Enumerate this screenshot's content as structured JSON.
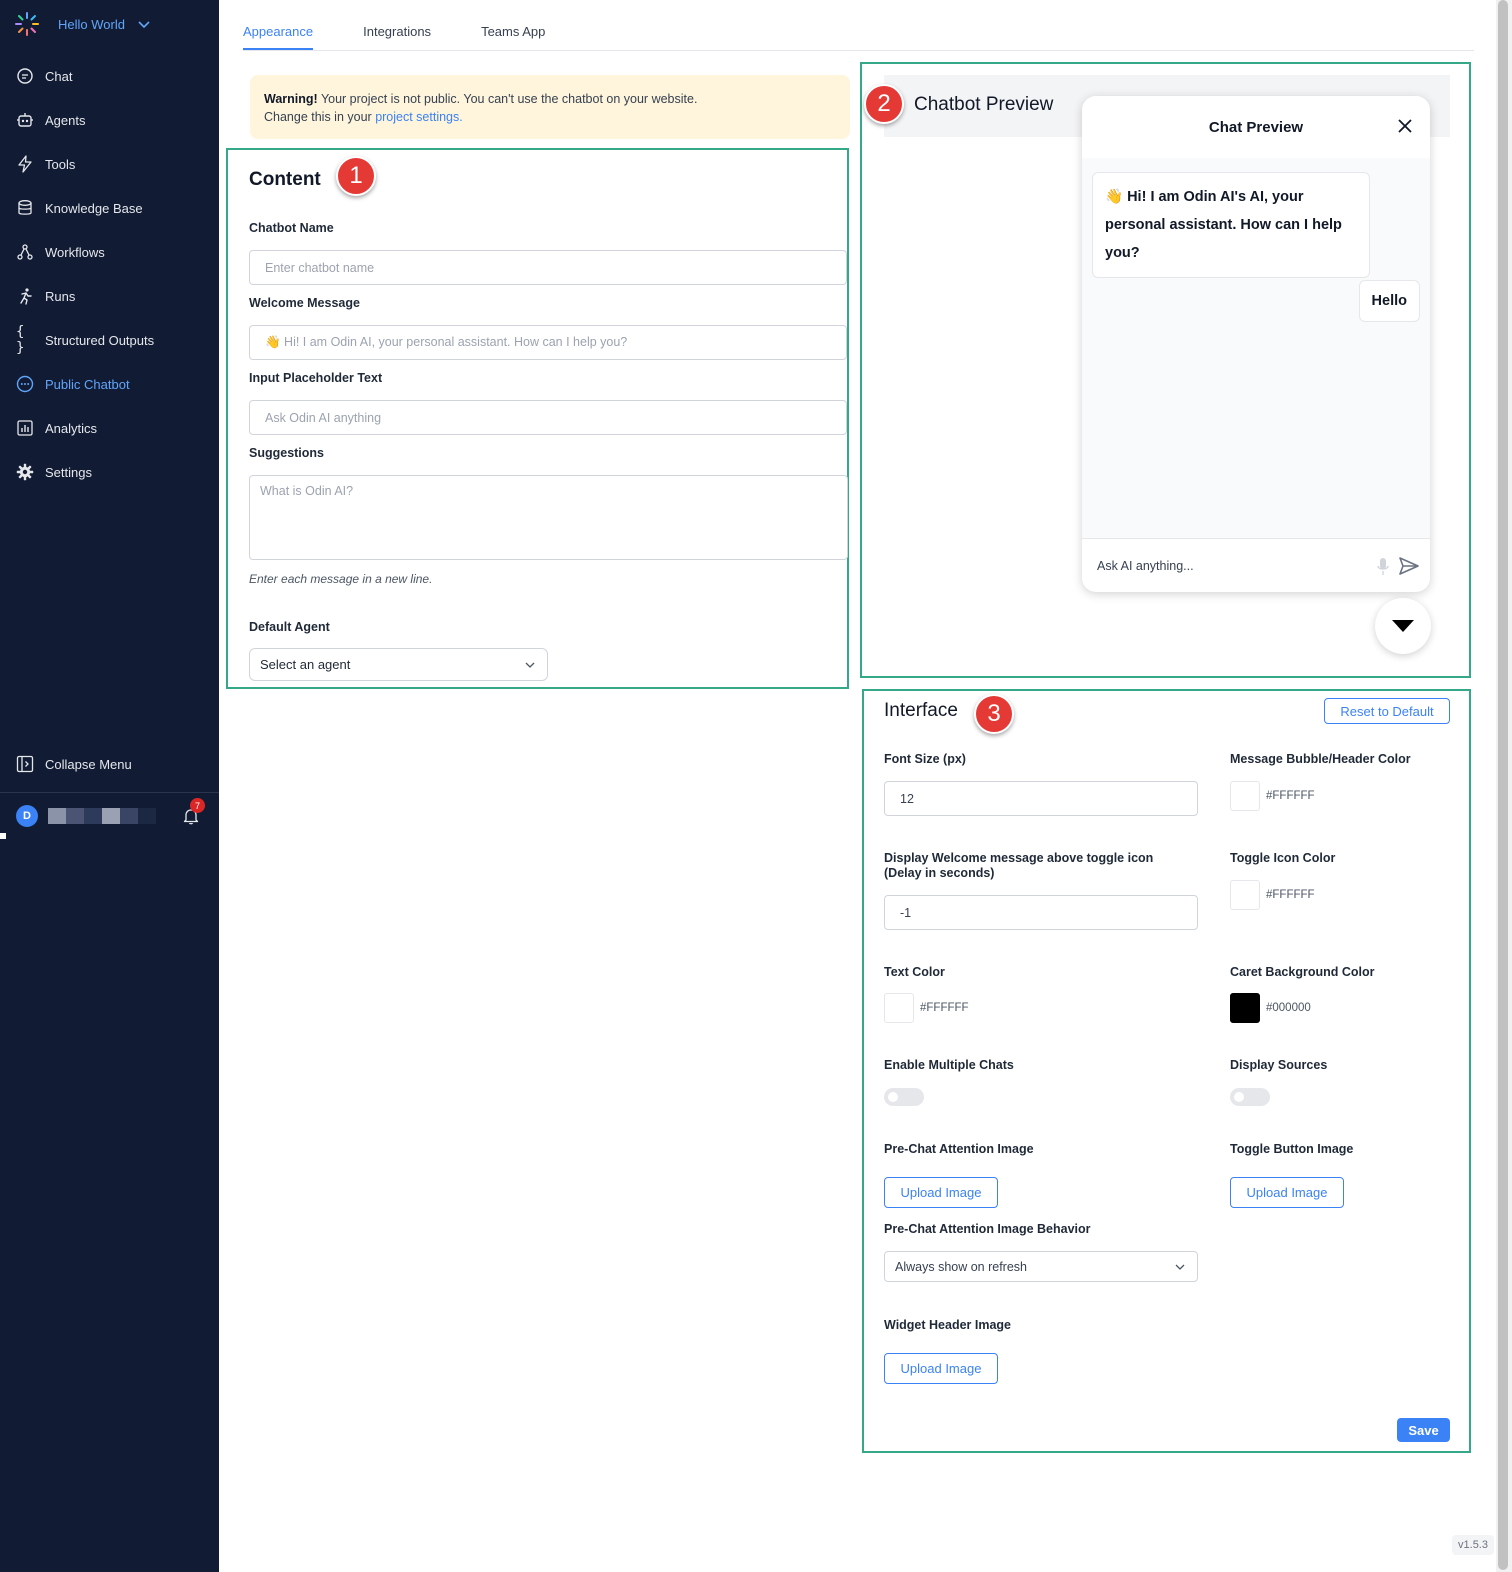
{
  "workspace": {
    "name": "Hello World"
  },
  "sidebar": {
    "items": [
      {
        "label": "Chat",
        "icon": "chat-bubble-icon"
      },
      {
        "label": "Agents",
        "icon": "robot-icon"
      },
      {
        "label": "Tools",
        "icon": "lightning-icon"
      },
      {
        "label": "Knowledge Base",
        "icon": "database-icon"
      },
      {
        "label": "Workflows",
        "icon": "workflow-icon"
      },
      {
        "label": "Runs",
        "icon": "runner-icon"
      },
      {
        "label": "Structured Outputs",
        "icon": "braces-icon"
      },
      {
        "label": "Public Chatbot",
        "icon": "chat-dots-icon",
        "active": true
      },
      {
        "label": "Analytics",
        "icon": "chart-icon"
      },
      {
        "label": "Settings",
        "icon": "gear-icon"
      }
    ],
    "collapse_label": "Collapse Menu",
    "user_initial": "D",
    "notification_count": "7"
  },
  "tabs": [
    {
      "label": "Appearance",
      "active": true
    },
    {
      "label": "Integrations"
    },
    {
      "label": "Teams App"
    }
  ],
  "warning": {
    "bold": "Warning!",
    "text": " Your project is not public. You can't use the chatbot on your website.",
    "line2": "Change this in your ",
    "link": "project settings."
  },
  "content": {
    "title": "Content",
    "badge": "1",
    "chatbot_name_label": "Chatbot Name",
    "chatbot_name_placeholder": "Enter chatbot name",
    "welcome_label": "Welcome Message",
    "welcome_value": "👋 Hi! I am Odin AI, your personal assistant. How can I help you?",
    "input_placeholder_label": "Input Placeholder Text",
    "input_placeholder_value": "Ask Odin AI anything",
    "suggestions_label": "Suggestions",
    "suggestions_placeholder": "What is Odin AI?",
    "suggestions_hint": "Enter each message in a new line.",
    "default_agent_label": "Default Agent",
    "default_agent_value": "Select an agent"
  },
  "preview": {
    "title": "Chatbot Preview",
    "badge": "2",
    "chat_title": "Chat Preview",
    "bot_message": "👋 Hi! I am Odin AI's AI, your personal assistant. How can I help you?",
    "user_message": "Hello",
    "input_placeholder": "Ask AI anything..."
  },
  "interface": {
    "title": "Interface",
    "badge": "3",
    "reset_label": "Reset to Default",
    "font_size_label": "Font Size (px)",
    "font_size_value": "12",
    "bubble_color_label": "Message Bubble/Header Color",
    "bubble_color": "#FFFFFF",
    "display_welcome_label_1": "Display Welcome message above toggle icon",
    "display_welcome_label_2": "(Delay in seconds)",
    "display_welcome_value": "-1",
    "toggle_icon_color_label": "Toggle Icon Color",
    "toggle_icon_color": "#FFFFFF",
    "text_color_label": "Text Color",
    "text_color": "#FFFFFF",
    "caret_bg_label": "Caret Background Color",
    "caret_bg_color": "#000000",
    "enable_multiple_label": "Enable Multiple Chats",
    "enable_multiple": false,
    "display_sources_label": "Display Sources",
    "display_sources": false,
    "pre_chat_image_label": "Pre-Chat Attention Image",
    "toggle_button_image_label": "Toggle Button Image",
    "upload_label": "Upload Image",
    "behavior_label": "Pre-Chat Attention Image Behavior",
    "behavior_value": "Always show on refresh",
    "widget_header_label": "Widget Header Image",
    "save_label": "Save"
  },
  "version": "v1.5.3",
  "colors": {
    "accent": "#3b82f6",
    "sidebar_bg": "#111c34",
    "highlight": "#34a889",
    "badge": "#e53935"
  }
}
